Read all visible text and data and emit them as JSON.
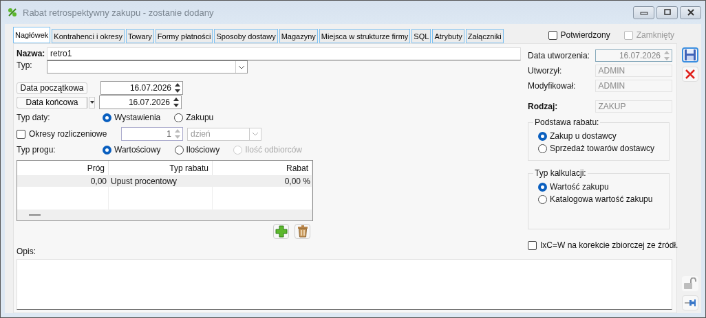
{
  "window": {
    "title": "Rabat retrospektywny zakupu - zostanie dodany"
  },
  "tabs": [
    {
      "label": "Nagłówek",
      "selected": true
    },
    {
      "label": "Kontrahenci i okresy",
      "selected": false
    },
    {
      "label": "Towary",
      "selected": false
    },
    {
      "label": "Formy płatności",
      "selected": false
    },
    {
      "label": "Sposoby dostawy",
      "selected": false
    },
    {
      "label": "Magazyny",
      "selected": false
    },
    {
      "label": "Miejsca w strukturze firmy",
      "selected": false
    },
    {
      "label": "SQL",
      "selected": false
    },
    {
      "label": "Atrybuty",
      "selected": false
    },
    {
      "label": "Załączniki",
      "selected": false
    }
  ],
  "header_checks": [
    {
      "label": "Potwierdzony",
      "checked": false,
      "disabled": false
    },
    {
      "label": "Zamknięty",
      "checked": false,
      "disabled": true
    }
  ],
  "nazwa": {
    "label": "Nazwa:",
    "value": "retro1"
  },
  "typ": {
    "label": "Typ:"
  },
  "dates": [
    {
      "button": "Data początkowa",
      "value": "16.07.2026",
      "has_menu": false
    },
    {
      "button": "Data końcowa",
      "value": "16.07.2026",
      "has_menu": true
    }
  ],
  "typ_daty": {
    "label": "Typ daty:",
    "options": [
      {
        "label": "Wystawienia",
        "selected": true,
        "disabled": false
      },
      {
        "label": "Zakupu",
        "selected": false,
        "disabled": false
      }
    ]
  },
  "okresy": {
    "label": "Okresy rozliczeniowe",
    "checked": false,
    "value": "1",
    "unit": "dzień"
  },
  "typ_progu": {
    "label": "Typ progu:",
    "options": [
      {
        "label": "Wartościowy",
        "selected": true,
        "disabled": false
      },
      {
        "label": "Ilościowy",
        "selected": false,
        "disabled": false
      },
      {
        "label": "Ilość odbiorców",
        "selected": false,
        "disabled": true
      }
    ]
  },
  "table": {
    "columns": [
      "Próg",
      "Typ rabatu",
      "Rabat"
    ],
    "rows": [
      [
        "0,00",
        "Upust procentowy",
        "0,00 %"
      ]
    ]
  },
  "opis": {
    "label": "Opis:"
  },
  "info": [
    {
      "label": "Data utworzenia:",
      "value": "16.07.2026",
      "kind": "date",
      "bold": false
    },
    {
      "label": "Utworzył:",
      "value": "ADMIN",
      "kind": "text",
      "bold": false
    },
    {
      "label": "Modyfikował:",
      "value": "ADMIN",
      "kind": "text",
      "bold": false
    },
    {
      "label": "Rodzaj:",
      "value": "ZAKUP",
      "kind": "text",
      "bold": true
    }
  ],
  "groups": [
    {
      "title": "Podstawa rabatu:",
      "options": [
        {
          "label": "Zakup u dostawcy",
          "selected": true,
          "disabled": false
        },
        {
          "label": "Sprzedaż towarów dostawcy",
          "selected": false,
          "disabled": false
        }
      ]
    },
    {
      "title": "Typ kalkulacji:",
      "options": [
        {
          "label": "Wartość zakupu",
          "selected": true,
          "disabled": false
        },
        {
          "label": "Katalogowa wartość zakupu",
          "selected": false,
          "disabled": false
        }
      ]
    }
  ],
  "ixc": {
    "label": "IxC=W na korekcie zbiorczej ze źródł.",
    "checked": false
  }
}
